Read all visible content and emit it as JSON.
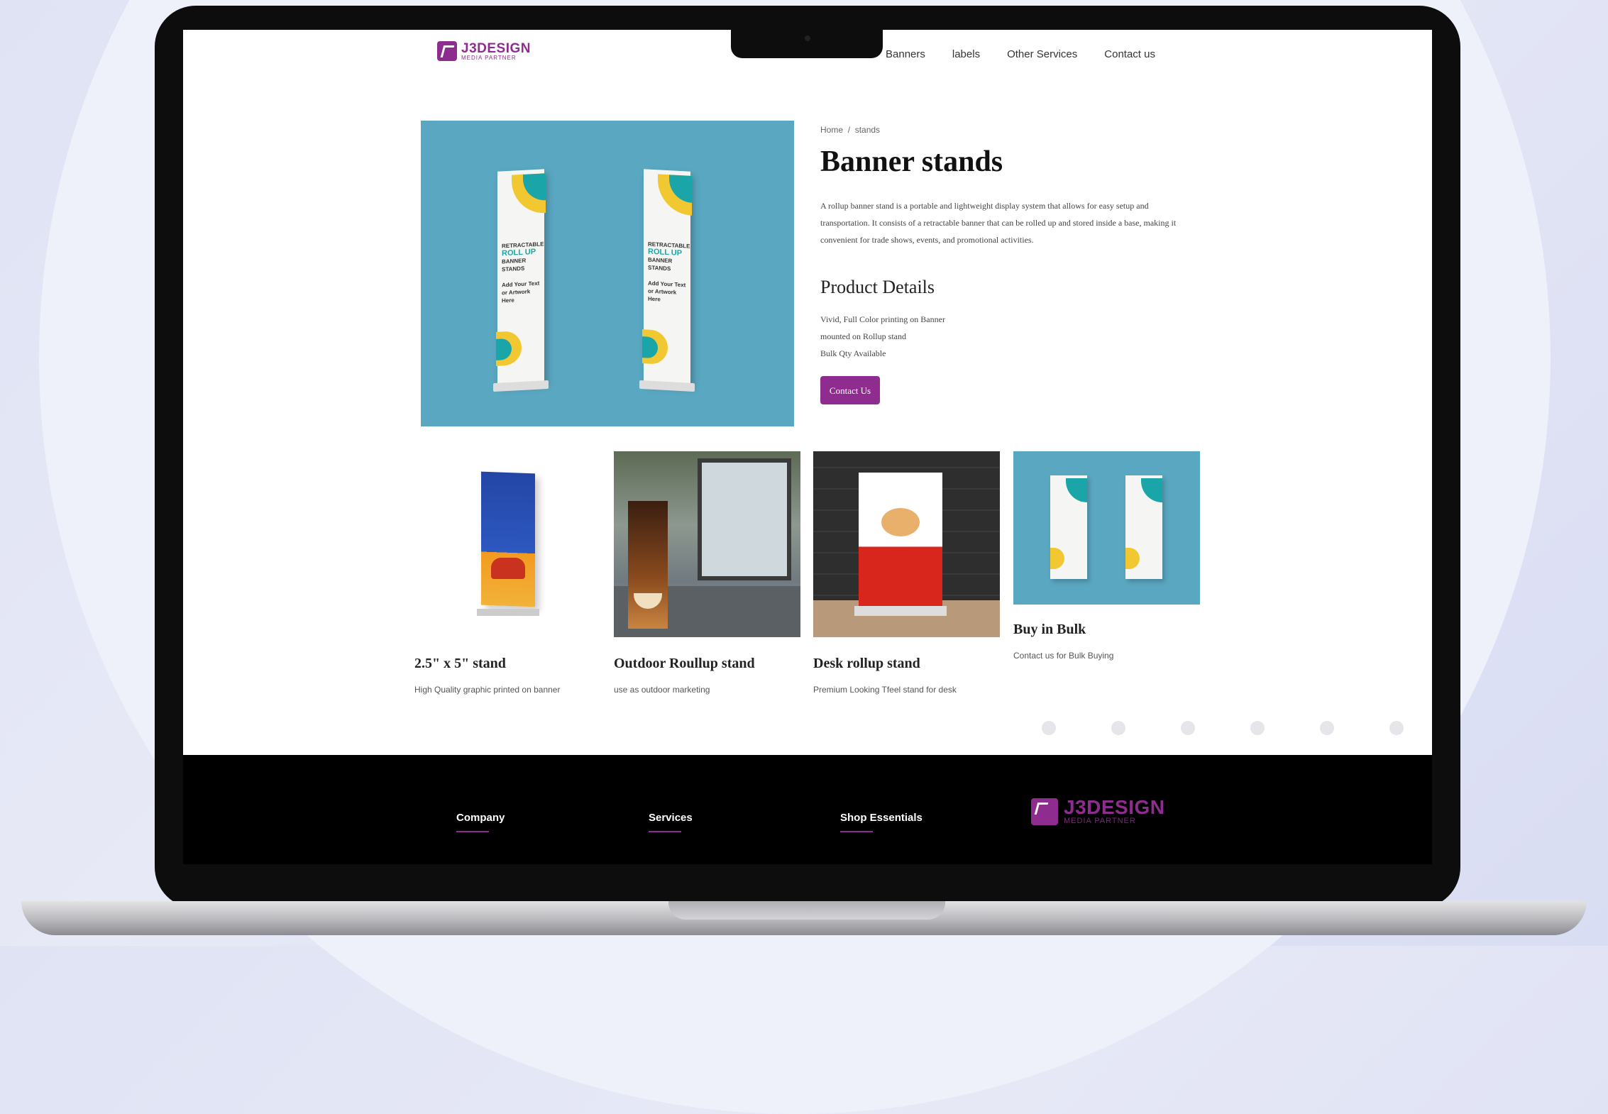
{
  "brand": {
    "name": "J3DESIGN",
    "tagline": "MEDIA PARTNER",
    "accent": "#8f2c8f"
  },
  "nav": {
    "items": [
      "Banners",
      "labels",
      "Other Services",
      "Contact us"
    ]
  },
  "breadcrumb": {
    "home": "Home",
    "sep": "/",
    "current": "stands"
  },
  "product": {
    "title": "Banner stands",
    "description": "A rollup banner stand is a portable and lightweight display system that allows for easy setup and transportation. It consists of a retractable banner that can be rolled up and stored inside a base, making it convenient for trade shows, events, and promotional activities.",
    "details_title": "Product Details",
    "details": [
      "Vivid, Full Color printing on Banner",
      "mounted on Rollup stand",
      "Bulk Qty Available"
    ],
    "cta": "Contact Us",
    "hero_stand_text": {
      "line1": "RETRACTABLE",
      "line2": "ROLL UP",
      "line3": "BANNER STANDS",
      "line4": "Add Your Text",
      "line5": "or Artwork Here"
    }
  },
  "cards": [
    {
      "name": "2.5\" x 5\" stand",
      "caption": "High Quality graphic printed on banner"
    },
    {
      "name": "Outdoor Roullup stand",
      "caption": "use as outdoor marketing"
    },
    {
      "name": "Desk rollup stand",
      "caption": "Premium Looking Tfeel stand for desk"
    },
    {
      "name": "Buy in Bulk",
      "caption": "Contact us for Bulk Buying"
    }
  ],
  "footer": {
    "columns": [
      "Company",
      "Services",
      "Shop Essentials"
    ]
  }
}
